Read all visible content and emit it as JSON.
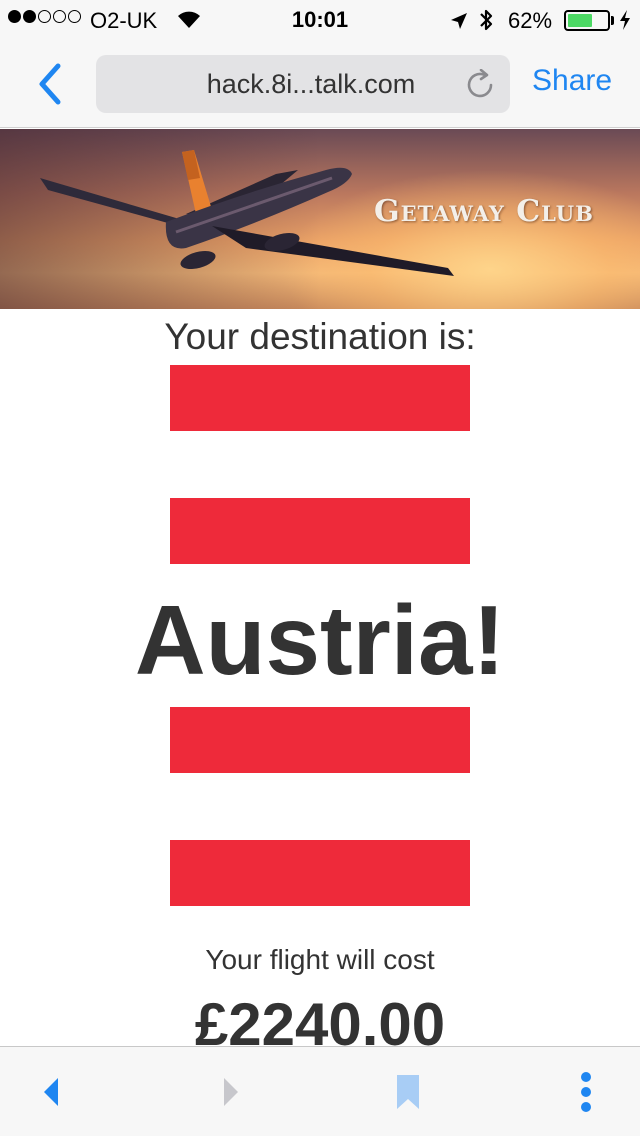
{
  "status_bar": {
    "carrier": "O2-UK",
    "time": "10:01",
    "battery_percent": "62%",
    "battery_level": 0.62,
    "signal_bars_filled": 2,
    "signal_bars_total": 5
  },
  "nav_bar": {
    "url": "hack.8i...talk.com",
    "share_label": "Share",
    "accent_color": "#1f86f1"
  },
  "banner": {
    "brand": "Getaway Club"
  },
  "content": {
    "destination_label": "Your destination is:",
    "country": "Austria!",
    "cost_label": "Your flight will cost",
    "price": "£2240.00",
    "flag_color": "#ee2a3a"
  },
  "toolbar": {
    "icons": [
      "back-arrow-icon",
      "forward-arrow-icon",
      "bookmark-icon",
      "more-icon"
    ]
  }
}
